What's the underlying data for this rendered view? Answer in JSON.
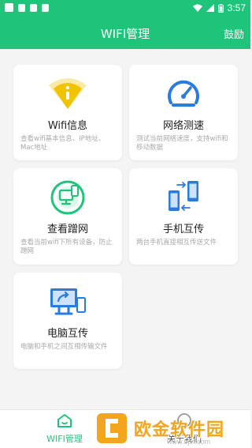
{
  "status_bar": {
    "time": "3:57",
    "left_icons": [
      "image-icon",
      "app-icon",
      "app-icon",
      "a-icon"
    ],
    "right_icons": [
      "wifi-icon",
      "signal-icon",
      "battery-icon"
    ]
  },
  "app_bar": {
    "title": "WIFI管理",
    "action": "鼓励"
  },
  "cards": [
    {
      "id": "wifi-info",
      "title": "Wifi信息",
      "desc": "查看wifi基本信息、IP地址、Mac地址",
      "icon": "wifi-info-icon"
    },
    {
      "id": "network-speed",
      "title": "网络测速",
      "desc": "测试当前网络速度，支持wifi和移动数据",
      "icon": "speedometer-icon"
    },
    {
      "id": "check-freeloader",
      "title": "查看蹭网",
      "desc": "查看当前wifi下所有设备，防止蹭网",
      "icon": "device-scan-icon"
    },
    {
      "id": "phone-transfer",
      "title": "手机互传",
      "desc": "两台手机直接相互传送文件",
      "icon": "phone-transfer-icon"
    },
    {
      "id": "pc-transfer",
      "title": "电脑互传",
      "desc": "电脑和手机之间互相传输文件",
      "icon": "pc-transfer-icon"
    }
  ],
  "bottom_nav": [
    {
      "label": "WIFI管理",
      "icon": "home-icon",
      "active": true
    },
    {
      "label": "关于我们",
      "icon": "info-icon",
      "active": false
    }
  ],
  "watermark": {
    "text": "欧金软件园",
    "sub": "www.ojin.com"
  },
  "colors": {
    "brand": "#1fc47b",
    "icon_blue": "#2a7be0",
    "wifi_yellow": "#f2c300",
    "watermark": "#f4a51e"
  }
}
